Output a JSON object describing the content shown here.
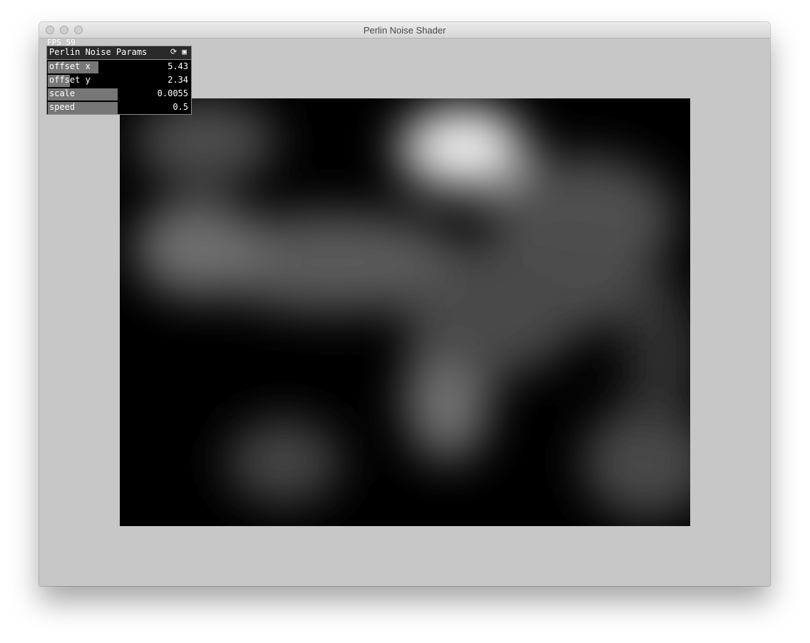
{
  "window": {
    "title": "Perlin Noise Shader"
  },
  "fps": {
    "text": "FPS 59"
  },
  "panel": {
    "title": "Perlin Noise Params",
    "icons": [
      "refresh-icon",
      "save-icon"
    ],
    "sliders": [
      {
        "name": "offset x",
        "value": "5.43",
        "fill": 0.36
      },
      {
        "name": "offset y",
        "value": "2.34",
        "fill": 0.16
      },
      {
        "name": "scale",
        "value": "0.0055",
        "fill": 0.5
      },
      {
        "name": "speed",
        "value": "0.5",
        "fill": 0.5
      }
    ]
  }
}
